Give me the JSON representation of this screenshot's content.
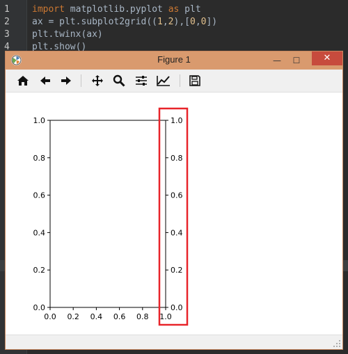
{
  "editor": {
    "lines": [
      {
        "num": "1",
        "parts": [
          {
            "t": "import",
            "c": "kw"
          },
          {
            "t": " matplotlib.pyplot ",
            "c": ""
          },
          {
            "t": "as",
            "c": "kw"
          },
          {
            "t": " plt",
            "c": ""
          }
        ]
      },
      {
        "num": "2",
        "parts": [
          {
            "t": "ax = plt.subplot2grid((",
            "c": ""
          },
          {
            "t": "1",
            "c": "num"
          },
          {
            "t": ",",
            "c": ""
          },
          {
            "t": "2",
            "c": "num"
          },
          {
            "t": "),[",
            "c": ""
          },
          {
            "t": "0",
            "c": "num"
          },
          {
            "t": ",",
            "c": ""
          },
          {
            "t": "0",
            "c": "num"
          },
          {
            "t": "])",
            "c": ""
          }
        ]
      },
      {
        "num": "3",
        "parts": [
          {
            "t": "plt.twinx(ax)",
            "c": ""
          }
        ]
      },
      {
        "num": "4",
        "parts": [
          {
            "t": "plt.show()",
            "c": ""
          }
        ]
      }
    ]
  },
  "window": {
    "title": "Figure 1",
    "minimize": "—",
    "maximize": "☐",
    "close": "✕"
  },
  "toolbar": {
    "tools": [
      "home-icon",
      "back-arrow-icon",
      "forward-arrow-icon",
      "pan-icon",
      "zoom-icon",
      "configure-subplots-icon",
      "edit-axis-icon",
      "save-icon"
    ]
  },
  "chart_data": {
    "type": "line",
    "x": [],
    "series": [],
    "xlim": [
      0.0,
      1.0
    ],
    "ylim": [
      0.0,
      1.0
    ],
    "y2lim": [
      0.0,
      1.0
    ],
    "xticks": [
      "0.0",
      "0.2",
      "0.4",
      "0.6",
      "0.8",
      "1.0"
    ],
    "yticks": [
      "0.0",
      "0.2",
      "0.4",
      "0.6",
      "0.8",
      "1.0"
    ],
    "y2ticks": [
      "0.0",
      "0.2",
      "0.4",
      "0.6",
      "0.8",
      "1.0"
    ],
    "grid": false,
    "highlight_color": "#e8242a"
  }
}
